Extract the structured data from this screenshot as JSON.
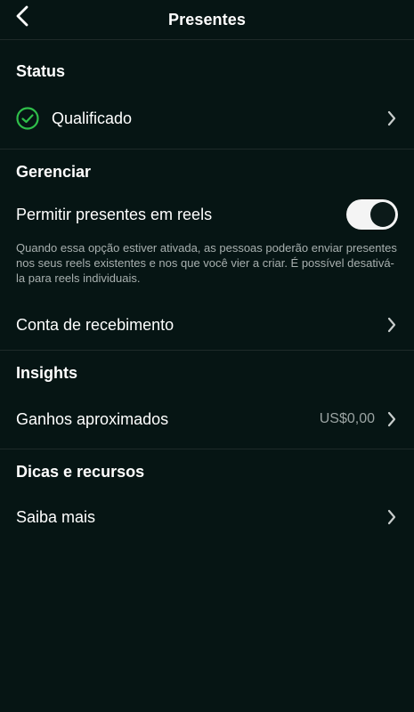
{
  "header": {
    "title": "Presentes"
  },
  "status": {
    "heading": "Status",
    "value": "Qualificado",
    "color": "#2fbf4a"
  },
  "manage": {
    "heading": "Gerenciar",
    "toggle_label": "Permitir presentes em reels",
    "toggle_on": true,
    "description": "Quando essa opção estiver ativada, as pessoas poderão enviar presentes nos seus reels existentes e nos que você vier a criar. É possível desativá-la para reels individuais.",
    "account_label": "Conta de recebimento"
  },
  "insights": {
    "heading": "Insights",
    "earnings_label": "Ganhos aproximados",
    "earnings_value": "US$0,00"
  },
  "tips": {
    "heading": "Dicas e recursos",
    "learn_more_label": "Saiba mais"
  }
}
